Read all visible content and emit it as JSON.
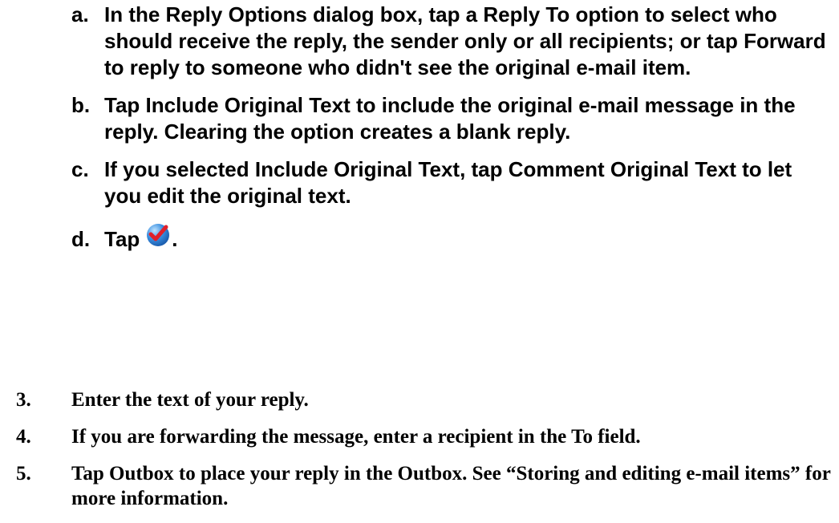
{
  "substeps": [
    {
      "letter": "a.",
      "text": "In the Reply Options dialog box, tap a Reply To option to select who should receive the reply, the sender only or all recipients; or tap Forward to reply to someone who didn't see the original e-mail item."
    },
    {
      "letter": "b.",
      "text": "Tap Include Original Text to include the original e-mail message in the reply. Clearing the option creates a blank reply."
    },
    {
      "letter": "c.",
      "text": "If you selected Include Original Text, tap Comment Original Text to let you edit the original text."
    },
    {
      "letter": "d.",
      "text_before": "Tap",
      "text_after": ".",
      "icon": "checkmark-done-icon"
    }
  ],
  "steps": [
    {
      "number": "3.",
      "text": "Enter the text of your reply."
    },
    {
      "number": "4.",
      "text": "If you are forwarding the message, enter a recipient in the To field."
    },
    {
      "number": "5.",
      "text": "Tap Outbox to place your reply in the Outbox. See “Storing and editing e-mail items” for more information."
    }
  ],
  "colors": {
    "text": "#000000",
    "icon_circle": "#3a8fe0",
    "icon_check": "#e0202a"
  }
}
